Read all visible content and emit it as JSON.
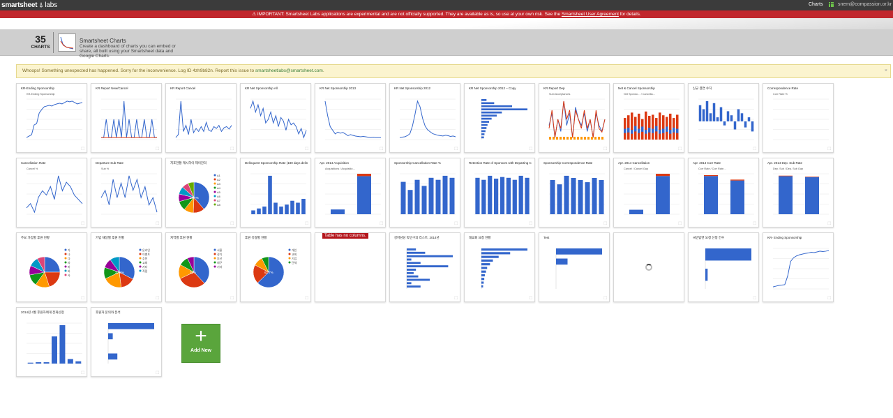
{
  "header": {
    "brand": "smartsheet",
    "brand_suffix": "labs",
    "nav_charts": "Charts",
    "user_email": "snem@compassion.or.kr"
  },
  "warning": {
    "text": "IMPORTANT: Smartsheet Labs applications are experimental and are not officially supported. They are available as is, so use at your own risk. See the",
    "link": "Smartsheet User Agreement",
    "tail": "for details."
  },
  "app": {
    "count": "35",
    "count_label": "CHARTS",
    "title": "Smartsheet Charts",
    "description": "Create a dashboard of charts you can embed or share, all built using your Smartsheet data and Google Charts."
  },
  "error": {
    "text": "Whoops! Something unexpected has happened. Sorry for the inconvenience. Log ID 4zh9b82n. Report this issue to",
    "link": "smartsheetlabs@smartsheet.com",
    "close": "×"
  },
  "add_new": {
    "label": "Add New",
    "plus": "+"
  },
  "colors": {
    "blue": "#3366cc",
    "red": "#dc3912",
    "orange": "#ff9900",
    "green": "#109618",
    "purple": "#990099",
    "teal": "#0099c6",
    "pink": "#dd4477",
    "lime": "#66aa00"
  },
  "cards": [
    {
      "title": "KR-Ending Sponsorship",
      "kind": "line",
      "legend": "KR-Ending Sponsorship",
      "values": [
        60,
        62,
        64,
        78,
        80,
        95,
        100,
        104,
        105,
        106,
        105,
        107,
        108,
        109,
        108,
        110,
        112,
        111,
        112,
        110,
        108,
        109,
        110
      ]
    },
    {
      "title": "KR Report New/Cancel",
      "kind": "line2",
      "values": [
        0,
        0,
        1,
        0,
        0,
        1,
        0,
        1,
        0,
        2,
        0,
        1,
        0,
        0,
        1,
        0,
        0,
        1,
        0,
        0,
        1,
        0,
        0
      ],
      "values2": [
        0,
        0,
        0,
        0,
        0,
        0,
        0,
        0,
        0,
        0,
        0,
        0,
        0,
        0,
        0,
        0,
        0,
        0,
        0,
        0,
        0,
        0,
        0
      ]
    },
    {
      "title": "KR Report Cancel",
      "kind": "line",
      "values": [
        20,
        25,
        80,
        30,
        40,
        25,
        50,
        28,
        35,
        30,
        38,
        30,
        45,
        32,
        30,
        38,
        35,
        40,
        30,
        36,
        38,
        34,
        40
      ]
    },
    {
      "title": "KR Net Sponsorship All",
      "kind": "line",
      "values": [
        60,
        80,
        50,
        70,
        40,
        60,
        20,
        30,
        50,
        20,
        40,
        10,
        35,
        25,
        0,
        30,
        15,
        20,
        10,
        -10,
        5,
        -20,
        0
      ]
    },
    {
      "title": "KR Net Sponsorship 2013",
      "kind": "line",
      "values": [
        100,
        60,
        30,
        20,
        10,
        15,
        12,
        14,
        10,
        5,
        8,
        6,
        4,
        3,
        2,
        3,
        2,
        1,
        0,
        1,
        0,
        0,
        0
      ]
    },
    {
      "title": "KR Net Sponsorship 2012",
      "kind": "line",
      "values": [
        0,
        1,
        2,
        5,
        10,
        30,
        60,
        95,
        80,
        50,
        30,
        20,
        15,
        10,
        8,
        6,
        5,
        4,
        6,
        5,
        3,
        4,
        2
      ]
    },
    {
      "title": "KR Net Sponsorship 2012 – Copy",
      "kind": "hbar",
      "values": [
        10,
        25,
        60,
        90,
        40,
        30,
        20,
        15,
        12,
        10,
        8,
        6,
        5
      ]
    },
    {
      "title": "KR Report Dep",
      "kind": "line3",
      "legend": "Sum Acceptances",
      "values": [
        50,
        60,
        40,
        55,
        45,
        70,
        50,
        60,
        40,
        65,
        55,
        50,
        60,
        45,
        55,
        40,
        60,
        50,
        45,
        55
      ],
      "values2": [
        30,
        40,
        25,
        35,
        30,
        45,
        35,
        40,
        25,
        40,
        35,
        30,
        40,
        30,
        35,
        25,
        40,
        30,
        28,
        35
      ]
    },
    {
      "title": "Net & Cancel Sponsorship",
      "kind": "stack",
      "legend": "Net Sponso… / Cancella…",
      "values": [
        40,
        45,
        50,
        42,
        48,
        38,
        52,
        44,
        46,
        40,
        50,
        45,
        42,
        48,
        40,
        46
      ],
      "values2": [
        20,
        22,
        18,
        25,
        20,
        24,
        18,
        22,
        20,
        25,
        18,
        20,
        24,
        18,
        22,
        20
      ]
    },
    {
      "title": "신규 결연 수치",
      "kind": "vbarneg",
      "values": [
        40,
        30,
        50,
        20,
        45,
        10,
        35,
        -10,
        25,
        15,
        -20,
        30,
        20,
        -15,
        10,
        -25
      ]
    },
    {
      "title": "Correspondence Rate",
      "kind": "flat",
      "legend": "Corr Rate %",
      "values": [
        70,
        71,
        72,
        72,
        71,
        71,
        70,
        70,
        69,
        69,
        68,
        68,
        68,
        67,
        67
      ]
    },
    {
      "title": "Cancellation Rate",
      "kind": "line",
      "legend": "Cancel %",
      "values": [
        40,
        42,
        38,
        45,
        48,
        46,
        50,
        44,
        55,
        48,
        52,
        50,
        46,
        44,
        42
      ]
    },
    {
      "title": "Departure Sub Rate",
      "kind": "line",
      "legend": "Sub %",
      "values": [
        50,
        52,
        48,
        55,
        50,
        54,
        50,
        56,
        52,
        55,
        50,
        53,
        48,
        50,
        46
      ]
    },
    {
      "title": "지포현황 캐시하이 제이찬리",
      "kind": "pie",
      "pct": "38.7%",
      "values": [
        38.7,
        12,
        10,
        10,
        8,
        8,
        7,
        6.3
      ],
      "labels": [
        "A1",
        "A2",
        "A3",
        "A4",
        "A5",
        "A6",
        "A7",
        "A8"
      ]
    },
    {
      "title": "Delinquent Sponsorship Rate (180 days delinquent)",
      "kind": "vbar",
      "sub": "KR",
      "values": [
        10,
        15,
        20,
        100,
        30,
        20,
        25,
        35,
        30,
        40
      ]
    },
    {
      "title": "Apr. 2014 Acquisition",
      "kind": "vbar2",
      "legend": "Acquisitions / Acquisitio…",
      "values": [
        10,
        80
      ],
      "values2": [
        0,
        5
      ]
    },
    {
      "title": "Sponsorship Cancellation Rate %",
      "kind": "vbar",
      "values": [
        80,
        60,
        85,
        70,
        90,
        85,
        95,
        90
      ]
    },
    {
      "title": "Retention Rate of Sponsors with Departing Child",
      "kind": "vbar",
      "values": [
        90,
        85,
        95,
        88,
        92,
        90,
        85,
        95,
        90
      ]
    },
    {
      "title": "Sponsorship Correspondence Rate",
      "kind": "vbar",
      "values": [
        80,
        70,
        90,
        85,
        80,
        75,
        85,
        80
      ]
    },
    {
      "title": "Apr. 2014 Cancellation",
      "kind": "vbar2",
      "legend": "Cancel / Cancel Gap",
      "values": [
        10,
        85
      ],
      "values2": [
        0,
        5
      ]
    },
    {
      "title": "Apr. 2014 Corr Rate",
      "kind": "vbar2",
      "legend": "Corr Rate / Corr Rate…",
      "values": [
        85,
        75
      ],
      "values2": [
        2,
        2
      ]
    },
    {
      "title": "Apr. 2014 Dep. Sub Rate",
      "kind": "vbar2",
      "legend": "Dep. Sub / Dep. Sub Gap",
      "values": [
        80,
        78
      ],
      "values2": [
        1,
        1
      ]
    },
    {
      "title": "주요 가입별 후원 현황",
      "kind": "pie",
      "values": [
        25,
        20,
        15,
        12,
        10,
        10,
        8
      ],
      "labels": [
        "가",
        "나",
        "다",
        "라",
        "마",
        "바",
        "사"
      ]
    },
    {
      "title": "가입 채널별 후원 현황",
      "kind": "pie",
      "pct": "32.6%",
      "values": [
        32.6,
        15.4,
        20,
        12,
        10,
        10
      ],
      "labels": [
        "온라인",
        "이벤트",
        "추천",
        "교회",
        "기타",
        "직접"
      ]
    },
    {
      "title": "지역별 후원 현황",
      "kind": "pie",
      "pct": "38%",
      "values": [
        38,
        30,
        15,
        10,
        7
      ],
      "labels": [
        "서울",
        "경기",
        "부산",
        "대구",
        "기타"
      ]
    },
    {
      "title": "후원 유형별 현황",
      "kind": "pie",
      "pct": "62.7%",
      "values": [
        62.7,
        20,
        10,
        7.3
      ],
      "labels": [
        "개인",
        "교회",
        "기업",
        "단체"
      ]
    },
    {
      "title": "",
      "kind": "nocol",
      "msg": "Table has no columns."
    },
    {
      "title": "강마담당 박민구의 리스트, 2014년",
      "kind": "hbar",
      "values": [
        20,
        40,
        100,
        10,
        30,
        90,
        20,
        15,
        25,
        50,
        10,
        30
      ]
    },
    {
      "title": "대교회 요청 현황",
      "kind": "hbar",
      "values": [
        80,
        50,
        30,
        20,
        15,
        10,
        8,
        6,
        5,
        4,
        3
      ]
    },
    {
      "title": "Test",
      "kind": "hbar",
      "values": [
        100,
        25,
        0,
        0
      ]
    },
    {
      "title": "",
      "kind": "spinner"
    },
    {
      "title": "국민답변 요청 신청 건수",
      "kind": "hbar",
      "values": [
        100,
        5
      ]
    },
    {
      "title": "KR- Ending Sponsorship",
      "kind": "line",
      "values": [
        10,
        12,
        14,
        15,
        16,
        40,
        80,
        90,
        95,
        98,
        100,
        102,
        103,
        105,
        104,
        106,
        108,
        107,
        108,
        110
      ]
    },
    {
      "title": "2014년 4월 후원자에게 전화신청",
      "kind": "vbar",
      "values": [
        2,
        3,
        3,
        60,
        85,
        10,
        5
      ]
    },
    {
      "title": "후원자 문의와 분석",
      "kind": "hbar",
      "values": [
        100,
        10,
        0,
        20
      ]
    }
  ]
}
